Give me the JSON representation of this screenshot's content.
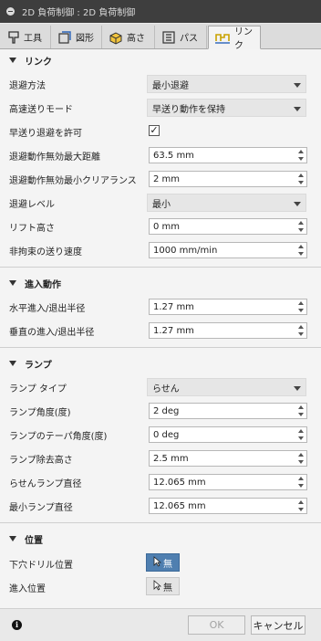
{
  "window": {
    "title": "2D 負荷制御 : 2D 負荷制御"
  },
  "tabs": [
    {
      "label": "工具",
      "icon": "tool-icon"
    },
    {
      "label": "図形",
      "icon": "geometry-icon"
    },
    {
      "label": "高さ",
      "icon": "heights-icon"
    },
    {
      "label": "パス",
      "icon": "passes-icon"
    },
    {
      "label": "リンク",
      "icon": "linking-icon",
      "active": true
    }
  ],
  "sections": {
    "link": {
      "title": "リンク",
      "retract_policy": {
        "label": "退避方法",
        "value": "最小退避"
      },
      "high_feed_mode": {
        "label": "高速送りモード",
        "value": "早送り動作を保持"
      },
      "allow_rapid_retract": {
        "label": "早送り退避を許可",
        "checked": true,
        "mark": "✓"
      },
      "max_stay_down_distance": {
        "label": "退避動作無効最大距離",
        "value": "63.5 mm"
      },
      "stay_down_clearance": {
        "label": "退避動作無効最小クリアランス",
        "value": "2 mm"
      },
      "stay_down_level": {
        "label": "退避レベル",
        "value": "最小"
      },
      "lift_height": {
        "label": "リフト高さ",
        "value": "0 mm"
      },
      "unconstrained_feed": {
        "label": "非拘束の送り速度",
        "value": "1000 mm/min"
      }
    },
    "leads": {
      "title": "進入動作",
      "horizontal_radius": {
        "label": "水平進入/退出半径",
        "value": "1.27 mm"
      },
      "vertical_radius": {
        "label": "垂直の進入/退出半径",
        "value": "1.27 mm"
      }
    },
    "ramp": {
      "title": "ランプ",
      "ramp_type": {
        "label": "ランプ タイプ",
        "value": "らせん"
      },
      "ramp_angle": {
        "label": "ランプ角度(度)",
        "value": "2 deg"
      },
      "ramp_taper_angle": {
        "label": "ランプのテーパ角度(度)",
        "value": "0 deg"
      },
      "ramp_clearance": {
        "label": "ランプ除去高さ",
        "value": "2.5 mm"
      },
      "helical_diameter": {
        "label": "らせんランプ直径",
        "value": "12.065 mm"
      },
      "min_ramp_diameter": {
        "label": "最小ランプ直径",
        "value": "12.065 mm"
      }
    },
    "positions": {
      "title": "位置",
      "predrill": {
        "label": "下穴ドリル位置",
        "button_text": "無",
        "active": true
      },
      "entry": {
        "label": "進入位置",
        "button_text": "無",
        "active": false
      }
    }
  },
  "footer": {
    "info": "i",
    "ok_label": "OK",
    "cancel_label": "キャンセル"
  },
  "colors": {
    "title_bg": "#3e3e3e",
    "panel_bg": "#f4f4f4",
    "active_button": "#4f7fb0"
  }
}
